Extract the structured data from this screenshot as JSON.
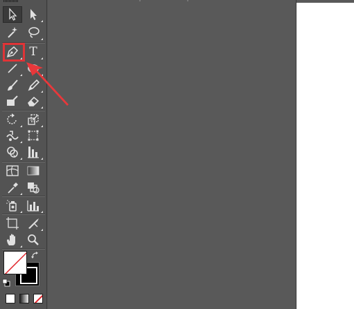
{
  "tools": {
    "type_glyph": "T"
  },
  "tool_icons": [
    "selection-icon",
    "direct-selection-icon",
    "magic-wand-icon",
    "lasso-icon",
    "pen-icon",
    "type-icon",
    "line-segment-icon",
    "ellipse-icon",
    "paintbrush-icon",
    "pencil-icon",
    "blob-brush-icon",
    "eraser-icon",
    "rotate-icon",
    "scale-icon",
    "warp-icon",
    "free-transform-icon",
    "shape-builder-icon",
    "perspective-grid-icon",
    "mesh-icon",
    "gradient-icon",
    "eyedropper-icon",
    "blend-icon",
    "symbol-sprayer-icon",
    "column-graph-icon",
    "artboard-icon",
    "slice-icon",
    "hand-icon",
    "zoom-icon"
  ],
  "active_tool": "pen-icon",
  "colors": {
    "panel": "#535353",
    "pasteboard": "#595959",
    "artboard": "#ffffff",
    "highlight": "#e03437",
    "icon": "#e0e0e0"
  },
  "swatches": {
    "fill": "none",
    "stroke": "#000000"
  }
}
